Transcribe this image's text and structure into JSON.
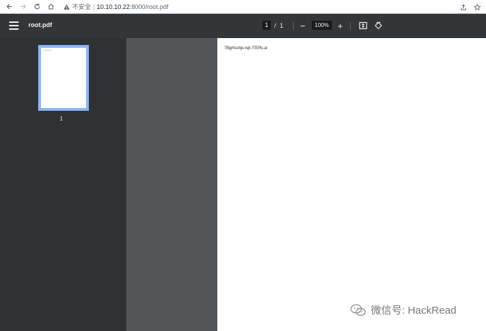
{
  "browser": {
    "security_label": "不安全",
    "url_host": "10.10.10.22",
    "url_path": ":8000/root.pdf",
    "nav_icons": [
      "back-arrow-icon",
      "forward-arrow-icon",
      "reload-icon",
      "home-icon"
    ],
    "right_icons": [
      "share-icon",
      "bookmark-star-icon"
    ]
  },
  "toolbar": {
    "title": "root.pdf",
    "current_page": "1",
    "page_separator": "/",
    "total_pages": "1",
    "zoom_out": "−",
    "zoom": "100%",
    "zoom_in": "+"
  },
  "sidebar": {
    "thumbnails": [
      {
        "page_label": "1"
      }
    ]
  },
  "document": {
    "text": "7Bgrhsshjs-rsjk /TEPic.al"
  },
  "watermark": {
    "text": "微信号: HackRead"
  },
  "colors": {
    "toolbar_bg": "#323639",
    "sidebar_bg": "#2f3235",
    "viewer_bg": "#525659",
    "thumb_border": "#8ab4f8"
  }
}
